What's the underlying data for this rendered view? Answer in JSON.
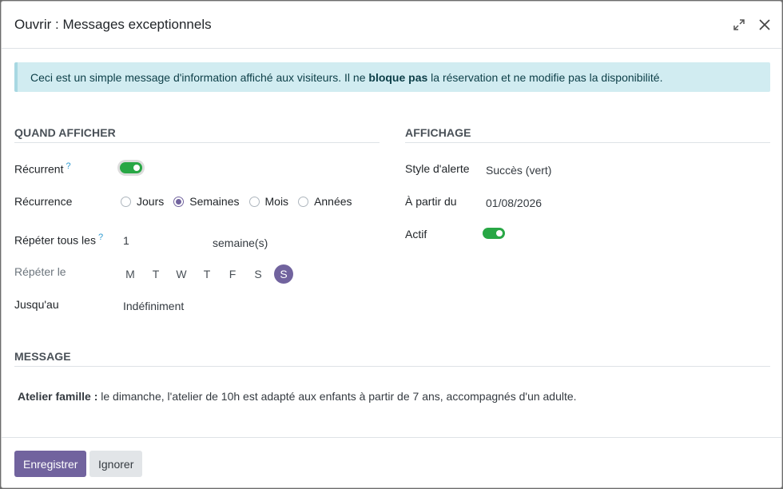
{
  "dialog": {
    "title": "Ouvrir : Messages exceptionnels",
    "expand_icon": "expand-icon",
    "close_icon": "close-icon"
  },
  "alert": {
    "text_before": "Ceci est un simple message d'information affiché aux visiteurs. Il ne ",
    "text_bold": "bloque pas",
    "text_after": " la réservation et ne modifie pas la disponibilité."
  },
  "when": {
    "section_title": "QUAND AFFICHER",
    "recurrent_label": "Récurrent",
    "recurrent_help": "?",
    "recurrent_on": true,
    "recurrence_label": "Récurrence",
    "recurrence_options": [
      "Jours",
      "Semaines",
      "Mois",
      "Années"
    ],
    "recurrence_selected": "Semaines",
    "repeat_every_label": "Répéter tous les",
    "repeat_every_help": "?",
    "repeat_every_value": "1",
    "repeat_every_unit": "semaine(s)",
    "repeat_on_label": "Répéter le",
    "weekdays": [
      "M",
      "T",
      "W",
      "T",
      "F",
      "S",
      "S"
    ],
    "weekday_selected_index": 6,
    "until_label": "Jusqu'au",
    "until_value": "Indéfiniment"
  },
  "display": {
    "section_title": "AFFICHAGE",
    "alert_style_label": "Style d'alerte",
    "alert_style_value": "Succès (vert)",
    "from_label": "À partir du",
    "from_value": "01/08/2026",
    "active_label": "Actif",
    "active_on": true
  },
  "message": {
    "section_title": "MESSAGE",
    "bold_part": "Atelier famille :",
    "text": " le dimanche, l'atelier de 10h est adapté aux enfants à partir de 7 ans, accompagnés d'un adulte."
  },
  "footer": {
    "save_label": "Enregistrer",
    "discard_label": "Ignorer"
  },
  "colors": {
    "primary": "#71639e",
    "toggle_on": "#28a745",
    "alert_bg": "#d1ecf1"
  }
}
